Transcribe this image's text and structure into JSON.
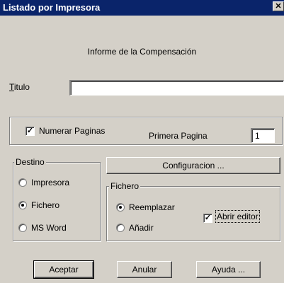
{
  "window": {
    "title": "Listado por Impresora",
    "close_glyph": "✕"
  },
  "heading": "Informe de la Compensación",
  "titulo": {
    "label_mnemonic": "T",
    "label_rest": "itulo",
    "value": ""
  },
  "numerar": {
    "label": "Numerar Paginas",
    "checked": true
  },
  "primera": {
    "label": "Primera Pagina",
    "value": "1"
  },
  "destino": {
    "legend": "Destino",
    "options": [
      {
        "label": "Impresora",
        "selected": false
      },
      {
        "label": "Fichero",
        "selected": true
      },
      {
        "label": "MS Word",
        "selected": false
      }
    ]
  },
  "configuracion_label": "Configuracion ...",
  "fichero": {
    "legend": "Fichero",
    "options": [
      {
        "label": "Reemplazar",
        "selected": true
      },
      {
        "label": "Añadir",
        "selected": false
      }
    ],
    "abrir_editor": {
      "label": "Abrir editor",
      "checked": true
    }
  },
  "buttons": {
    "aceptar": "Aceptar",
    "anular": "Anular",
    "ayuda": "Ayuda ..."
  },
  "icons": {
    "checkmark": "✓"
  }
}
